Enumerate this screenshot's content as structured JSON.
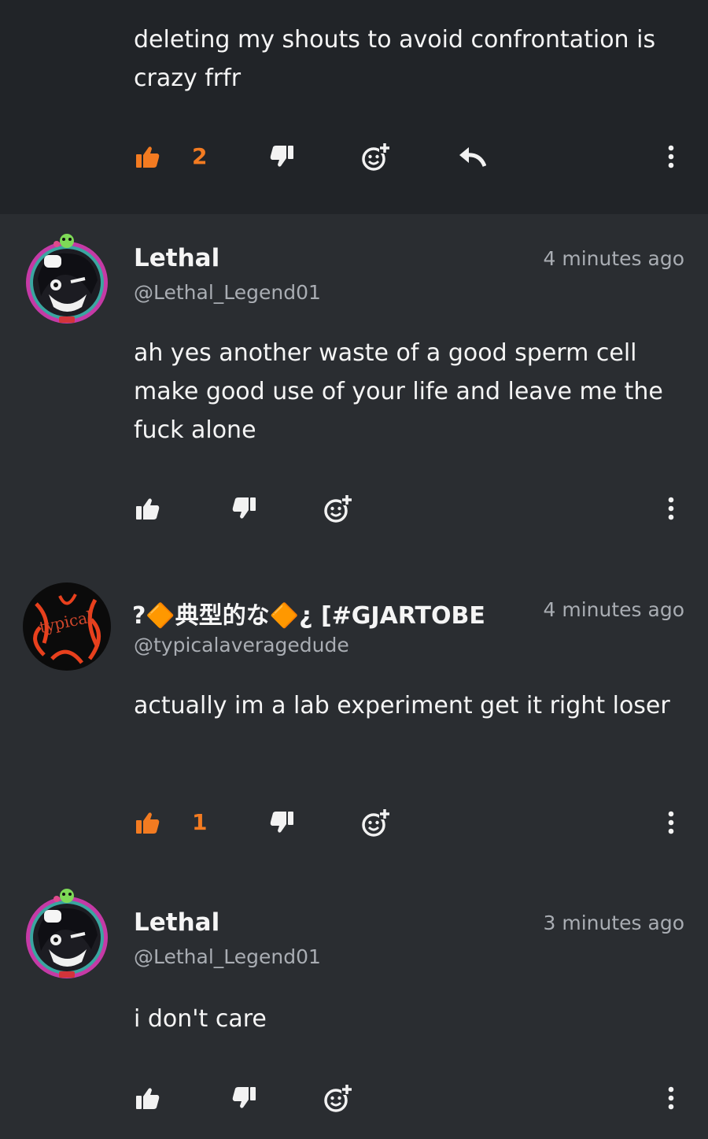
{
  "colors": {
    "accent": "#f37b21",
    "text": "#f5f5f5",
    "muted": "#a9adb3",
    "card": "#2a2d31"
  },
  "comments": [
    {
      "text": "deleting my shouts to avoid confrontation is crazy frfr",
      "likes": "2",
      "liked": true,
      "has_reply": true
    },
    {
      "author": "Lethal",
      "handle": "@Lethal_Legend01",
      "time": "4 minutes ago",
      "text": "ah yes another waste of a good sperm cell make good use of your life and leave me the fuck alone",
      "likes": "",
      "liked": false
    },
    {
      "author": "?🔶典型的な🔶¿ [#GJARTOBE",
      "handle": "@typicalaveragedude",
      "time": "4 minutes ago",
      "text": "actually im a lab experiment get it right loser",
      "likes": "1",
      "liked": true,
      "avatar_text": "typical"
    },
    {
      "author": "Lethal",
      "handle": "@Lethal_Legend01",
      "time": "3 minutes ago",
      "text": "i don't care",
      "likes": "",
      "liked": false
    }
  ],
  "icons": {
    "like": "thumbs-up-icon",
    "dislike": "thumbs-down-icon",
    "react": "add-reaction-icon",
    "reply": "reply-icon",
    "more": "more-vertical-icon"
  }
}
